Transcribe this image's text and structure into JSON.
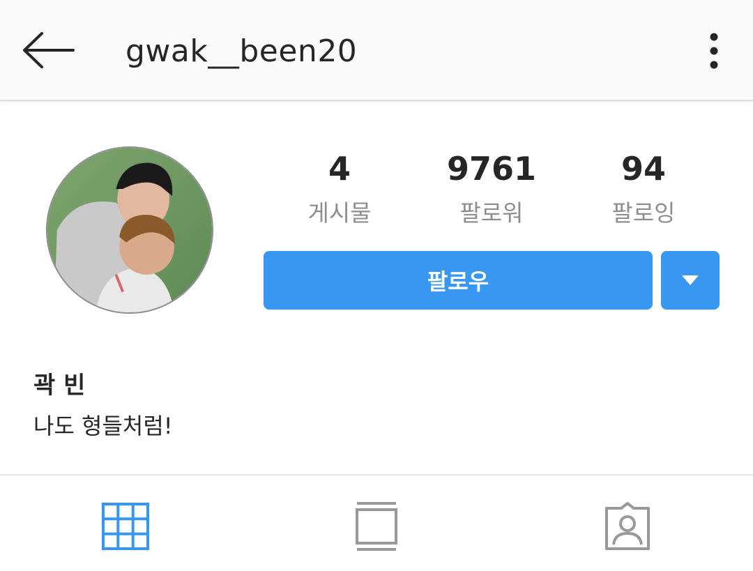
{
  "header": {
    "username": "gwak__been20",
    "back_icon": "arrow-left-icon",
    "more_icon": "more-vertical-icon"
  },
  "profile": {
    "avatar_icon": "profile-photo",
    "stats": [
      {
        "value": "4",
        "label": "게시물"
      },
      {
        "value": "9761",
        "label": "팔로워"
      },
      {
        "value": "94",
        "label": "팔로잉"
      }
    ],
    "follow_label": "팔로우",
    "dropdown_icon": "caret-down-icon",
    "display_name": "곽 빈",
    "bio": "나도 형들처럼!"
  },
  "tabs": [
    {
      "icon": "grid-icon",
      "active": true
    },
    {
      "icon": "list-feed-icon",
      "active": false
    },
    {
      "icon": "tagged-user-icon",
      "active": false
    }
  ],
  "colors": {
    "accent": "#3897f0",
    "text": "#262626",
    "muted": "#8e8e8e",
    "inactive_icon": "#999999"
  }
}
